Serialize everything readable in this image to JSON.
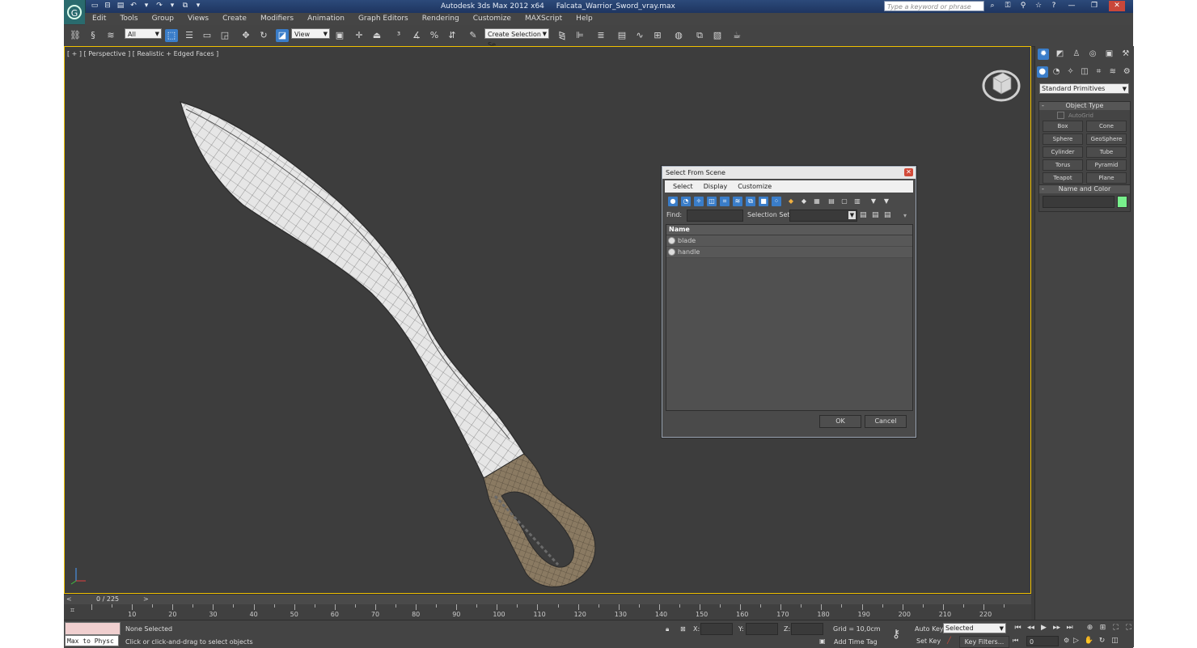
{
  "window": {
    "app_title": "Autodesk 3ds Max  2012 x64",
    "file_name": "Falcata_Warrior_Sword_vray.max",
    "search_placeholder": "Type a keyword or phrase"
  },
  "menu": [
    "Edit",
    "Tools",
    "Group",
    "Views",
    "Create",
    "Modifiers",
    "Animation",
    "Graph Editors",
    "Rendering",
    "Customize",
    "MAXScript",
    "Help"
  ],
  "toolbar": {
    "filter_value": "All",
    "ref_coord_value": "View",
    "named_selection_value": "Create Selection Se"
  },
  "viewport": {
    "label": "[ + ] [ Perspective ] [ Realistic + Edged Faces ]"
  },
  "command_panel": {
    "category_value": "Standard Primitives",
    "object_type_title": "Object Type",
    "autogrid_label": "AutoGrid",
    "buttons": [
      "Box",
      "Cone",
      "Sphere",
      "GeoSphere",
      "Cylinder",
      "Tube",
      "Torus",
      "Pyramid",
      "Teapot",
      "Plane"
    ],
    "name_color_title": "Name and Color",
    "object_color": "#78f08c"
  },
  "dialog": {
    "title": "Select From Scene",
    "menu": [
      "Select",
      "Display",
      "Customize"
    ],
    "find_label": "Find:",
    "selection_set_label": "Selection Set:",
    "column_name": "Name",
    "rows": [
      "blade",
      "handle"
    ],
    "ok_label": "OK",
    "cancel_label": "Cancel"
  },
  "timeline": {
    "frame_counter": "0 / 225",
    "ticks": [
      "10",
      "20",
      "30",
      "40",
      "50",
      "60",
      "70",
      "80",
      "90",
      "100",
      "110",
      "120",
      "130",
      "140",
      "150",
      "160",
      "170",
      "180",
      "190",
      "200",
      "210",
      "220"
    ]
  },
  "status": {
    "maxscript_text": "Max to Physc",
    "selection_text": "None Selected",
    "prompt_text": "Click or click-and-drag to select objects",
    "x_label": "X:",
    "y_label": "Y:",
    "z_label": "Z:",
    "grid_text": "Grid = 10,0cm",
    "add_time_tag": "Add Time Tag",
    "auto_key": "Auto Key",
    "set_key": "Set Key",
    "key_mode_value": "Selected",
    "key_filters": "Key Filters...",
    "current_frame": "0"
  },
  "colors": {
    "active_tool": "#3a7dc9",
    "viewport_border": "#f0c000"
  }
}
